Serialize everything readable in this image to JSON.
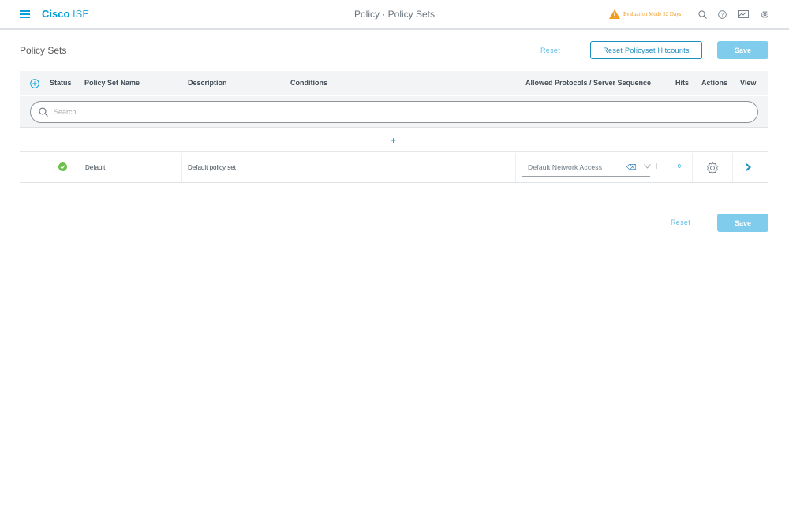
{
  "header": {
    "brand_bold": "Cisco",
    "brand_light": "ISE",
    "page_title": "Policy · Policy Sets",
    "evaluation_text": "Evaluation Mode 52 Days",
    "colors": {
      "accent": "#049fd9",
      "warning": "#f29c1f"
    },
    "icons": [
      "menu-icon",
      "warning-icon",
      "search-icon",
      "help-icon",
      "dashboard-icon",
      "settings-icon"
    ]
  },
  "toolbar": {
    "title": "Policy Sets",
    "reset_label": "Reset",
    "reset_hitcounts_label": "Reset Policyset Hitcounts",
    "save_label": "Save"
  },
  "table": {
    "columns": {
      "status": "Status",
      "name": "Policy Set Name",
      "description": "Description",
      "conditions": "Conditions",
      "protocols": "Allowed Protocols / Server Sequence",
      "hits": "Hits",
      "actions": "Actions",
      "view": "View"
    },
    "search_placeholder": "Search",
    "add_row_symbol": "+",
    "rows": [
      {
        "status": "enabled",
        "name": "Default",
        "description": "Default policy set",
        "conditions": "",
        "protocols": "Default Network Access",
        "hits": "0"
      }
    ]
  },
  "footer": {
    "reset_label": "Reset",
    "save_label": "Save"
  }
}
